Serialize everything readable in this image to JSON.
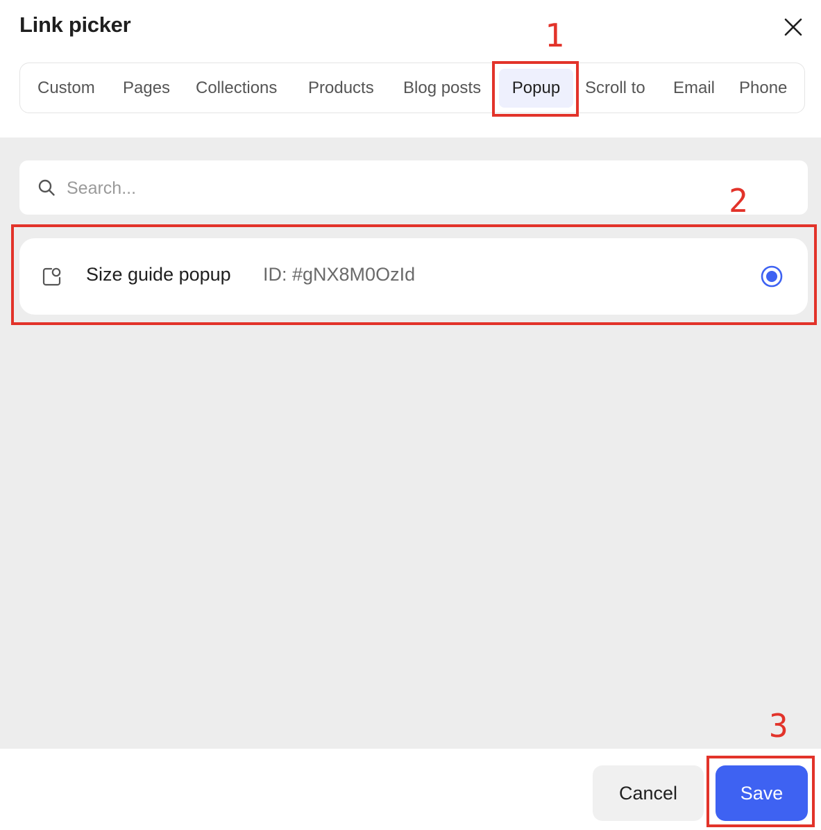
{
  "dialog": {
    "title": "Link picker"
  },
  "tabs": [
    {
      "label": "Custom",
      "active": false
    },
    {
      "label": "Pages",
      "active": false
    },
    {
      "label": "Collections",
      "active": false
    },
    {
      "label": "Products",
      "active": false
    },
    {
      "label": "Blog posts",
      "active": false
    },
    {
      "label": "Popup",
      "active": true
    },
    {
      "label": "Scroll to",
      "active": false
    },
    {
      "label": "Email",
      "active": false
    },
    {
      "label": "Phone",
      "active": false
    }
  ],
  "search": {
    "value": "",
    "placeholder": "Search..."
  },
  "items": [
    {
      "name": "Size guide popup",
      "id_text": "ID: #gNX8M0OzId",
      "selected": true
    }
  ],
  "footer": {
    "cancel_label": "Cancel",
    "save_label": "Save"
  },
  "annotations": [
    {
      "number": "1"
    },
    {
      "number": "2"
    },
    {
      "number": "3"
    }
  ],
  "colors": {
    "accent": "#3e62f2",
    "active_tab_bg": "#eef0fd",
    "annotation": "#e2332a",
    "body_bg": "#ededed"
  }
}
